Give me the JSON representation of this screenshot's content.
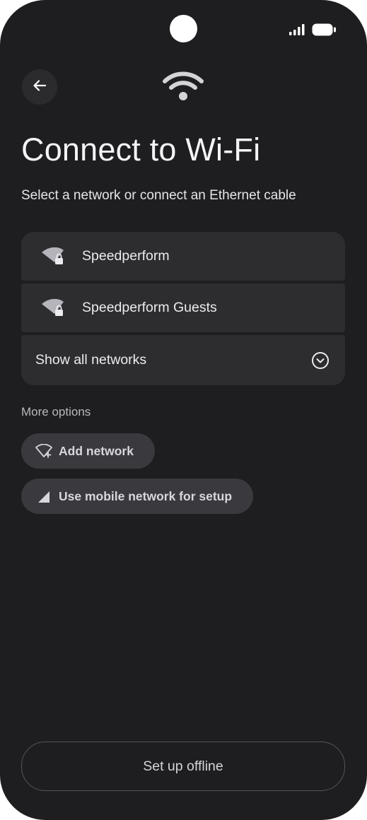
{
  "status_bar": {
    "signal_icon": "cellular-signal-icon",
    "battery_icon": "battery-icon"
  },
  "header": {
    "back_icon": "arrow-back-icon",
    "wifi_icon": "wifi-icon"
  },
  "page": {
    "title": "Connect to Wi-Fi",
    "subtitle": "Select a network or connect an Ethernet cable"
  },
  "networks": [
    {
      "name": "Speedperform",
      "icon": "wifi-locked-icon"
    },
    {
      "name": "Speedperform Guests",
      "icon": "wifi-locked-icon"
    }
  ],
  "show_all": {
    "label": "Show all networks",
    "icon": "expand-circle-down-icon"
  },
  "more_options": {
    "heading": "More options",
    "add_network": {
      "label": "Add network",
      "icon": "wifi-add-icon"
    },
    "mobile_network": {
      "label": "Use mobile network for setup",
      "icon": "cellular-icon"
    }
  },
  "footer": {
    "offline_label": "Set up offline"
  },
  "colors": {
    "background": "#1e1e20",
    "surface": "#2d2d30",
    "chip": "#3a3a3e",
    "text": "#ececf0"
  }
}
